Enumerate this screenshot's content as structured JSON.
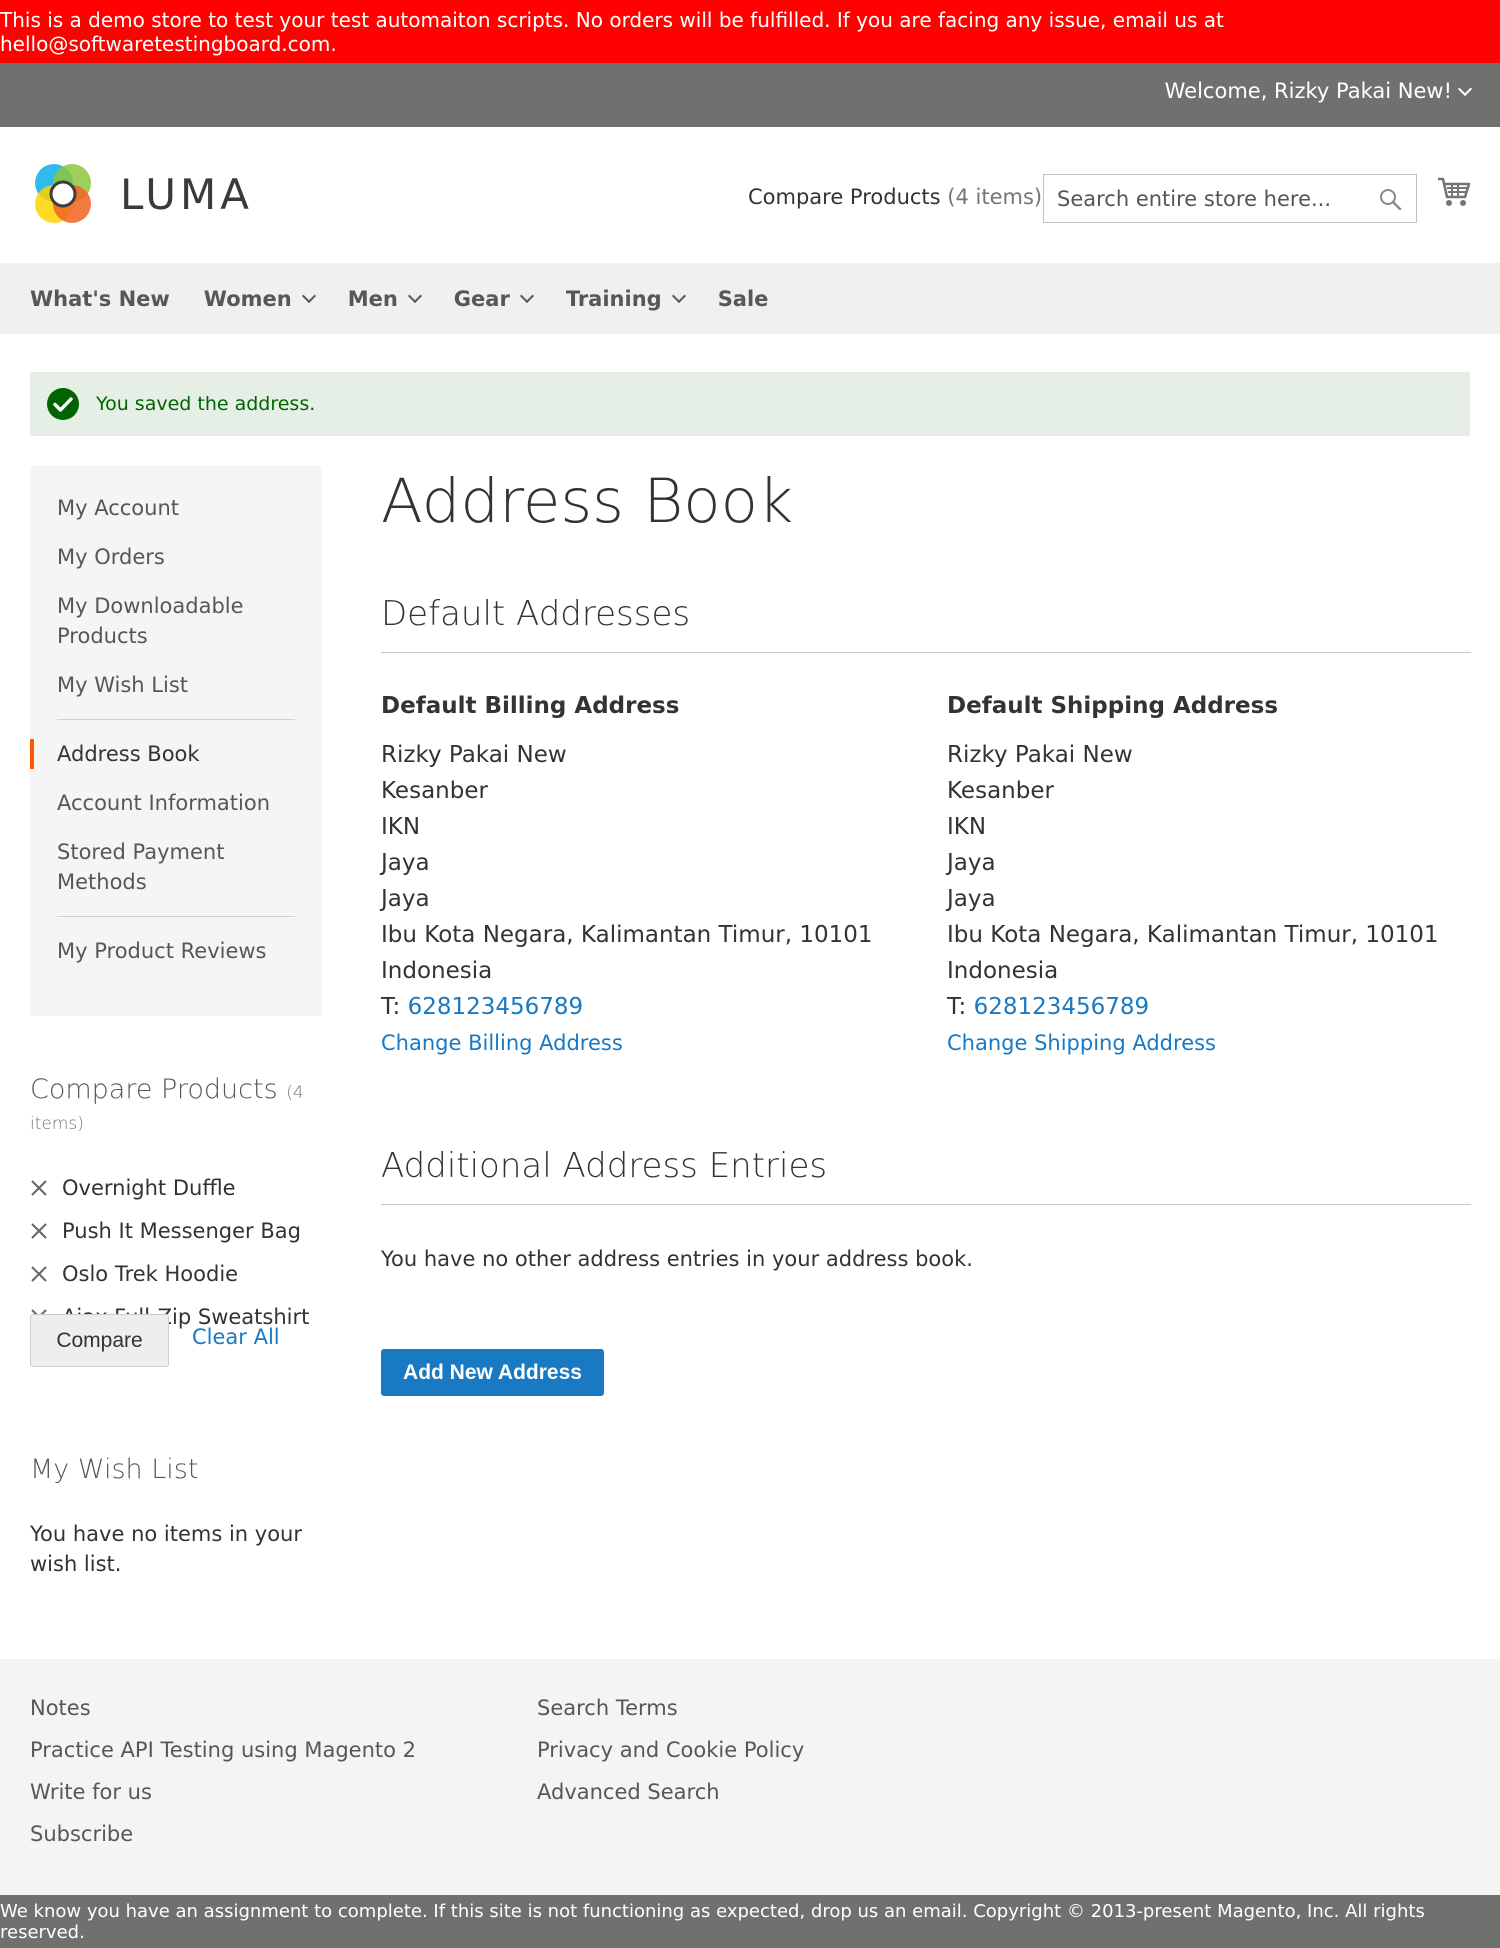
{
  "banner": {
    "text": "This is a demo store to test your test automaiton scripts. No orders will be fulfilled. If you are facing any issue, email us at hello@softwaretestingboard.com."
  },
  "topbar": {
    "welcome": "Welcome, Rizky Pakai New!"
  },
  "header": {
    "logo_text": "LUMA",
    "compare_label": "Compare Products",
    "compare_count": "(4 items)",
    "search_placeholder": "Search entire store here..."
  },
  "nav": {
    "items": [
      "What's New",
      "Women",
      "Men",
      "Gear",
      "Training",
      "Sale"
    ]
  },
  "message": {
    "success": "You saved the address."
  },
  "sidebar": {
    "items": [
      "My Account",
      "My Orders",
      "My Downloadable Products",
      "My Wish List",
      "Address Book",
      "Account Information",
      "Stored Payment Methods",
      "My Product Reviews"
    ]
  },
  "compare_block": {
    "title": "Compare Products",
    "count": "(4 items)",
    "products": [
      "Overnight Duffle",
      "Push It Messenger Bag",
      "Oslo Trek Hoodie",
      "Ajax Full-Zip Sweatshirt"
    ],
    "compare_button": "Compare",
    "clear_all": "Clear All"
  },
  "wishlist_block": {
    "title": "My Wish List",
    "empty": "You have no items in your wish list."
  },
  "main": {
    "page_title": "Address Book",
    "default_section": "Default Addresses",
    "billing": {
      "title": "Default Billing Address",
      "lines": [
        "Rizky Pakai New",
        "Kesanber",
        "IKN",
        "Jaya",
        "Jaya",
        "Ibu Kota Negara, Kalimantan Timur, 10101",
        "Indonesia"
      ],
      "phone_prefix": "T: ",
      "phone": "628123456789",
      "action": "Change Billing Address"
    },
    "shipping": {
      "title": "Default Shipping Address",
      "lines": [
        "Rizky Pakai New",
        "Kesanber",
        "IKN",
        "Jaya",
        "Jaya",
        "Ibu Kota Negara, Kalimantan Timur, 10101",
        "Indonesia"
      ],
      "phone_prefix": "T: ",
      "phone": "628123456789",
      "action": "Change Shipping Address"
    },
    "additional_section": "Additional Address Entries",
    "no_entries": "You have no other address entries in your address book.",
    "add_button": "Add New Address"
  },
  "footer": {
    "col1": [
      "Notes",
      "Practice API Testing using Magento 2",
      "Write for us",
      "Subscribe"
    ],
    "col2": [
      "Search Terms",
      "Privacy and Cookie Policy",
      "Advanced Search"
    ],
    "copyright": "We know you have an assignment to complete. If this site is not functioning as expected, drop us an email. Copyright © 2013-present Magento, Inc. All rights reserved."
  },
  "colors": {
    "banner": "#ff0101",
    "topbar": "#6e716e",
    "link": "#1979c3",
    "accent": "#ff5501",
    "success_bg": "#e5efe5",
    "success_text": "#006400"
  },
  "icons": [
    "chevron-down-icon",
    "search-icon",
    "cart-icon",
    "check-circle-icon",
    "remove-x-icon",
    "luma-logo-icon"
  ]
}
